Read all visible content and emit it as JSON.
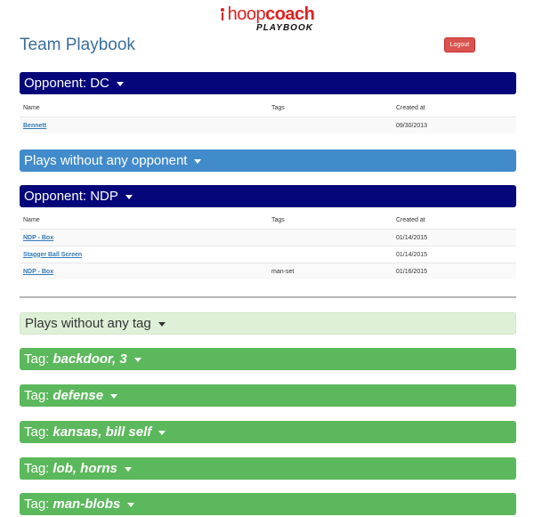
{
  "logo": {
    "hoop": "hoop",
    "coach": "coach",
    "sub": "PLAYBOOK"
  },
  "page": {
    "title": "Team Playbook",
    "logout_label": "Logout"
  },
  "table_headers": {
    "name": "Name",
    "tags": "Tags",
    "created": "Created at"
  },
  "opponent_dc": {
    "label": "Opponent: DC",
    "rows": [
      {
        "name": "Bennett",
        "tags": "",
        "created": "09/30/2013"
      }
    ]
  },
  "no_opponent": {
    "label": "Plays without any opponent"
  },
  "opponent_ndp": {
    "label": "Opponent: NDP",
    "rows": [
      {
        "name": "NDP - Box",
        "tags": "",
        "created": "01/14/2015"
      },
      {
        "name": "Stagger Ball Screen",
        "tags": "",
        "created": "01/14/2015"
      },
      {
        "name": "NDP - Box",
        "tags": "man-set",
        "created": "01/16/2015"
      }
    ]
  },
  "no_tag": {
    "label": "Plays without any tag"
  },
  "tags": [
    {
      "prefix": "Tag:",
      "name": "backdoor, 3"
    },
    {
      "prefix": "Tag:",
      "name": "defense"
    },
    {
      "prefix": "Tag:",
      "name": "kansas, bill self"
    },
    {
      "prefix": "Tag:",
      "name": "lob, horns"
    },
    {
      "prefix": "Tag:",
      "name": "man-blobs"
    }
  ],
  "colors": {
    "navy": "#040679",
    "blue": "#428bca",
    "green": "#5cb85c",
    "light_green": "#dff0d8",
    "logout": "#d9534f",
    "title": "#3a6d99"
  }
}
